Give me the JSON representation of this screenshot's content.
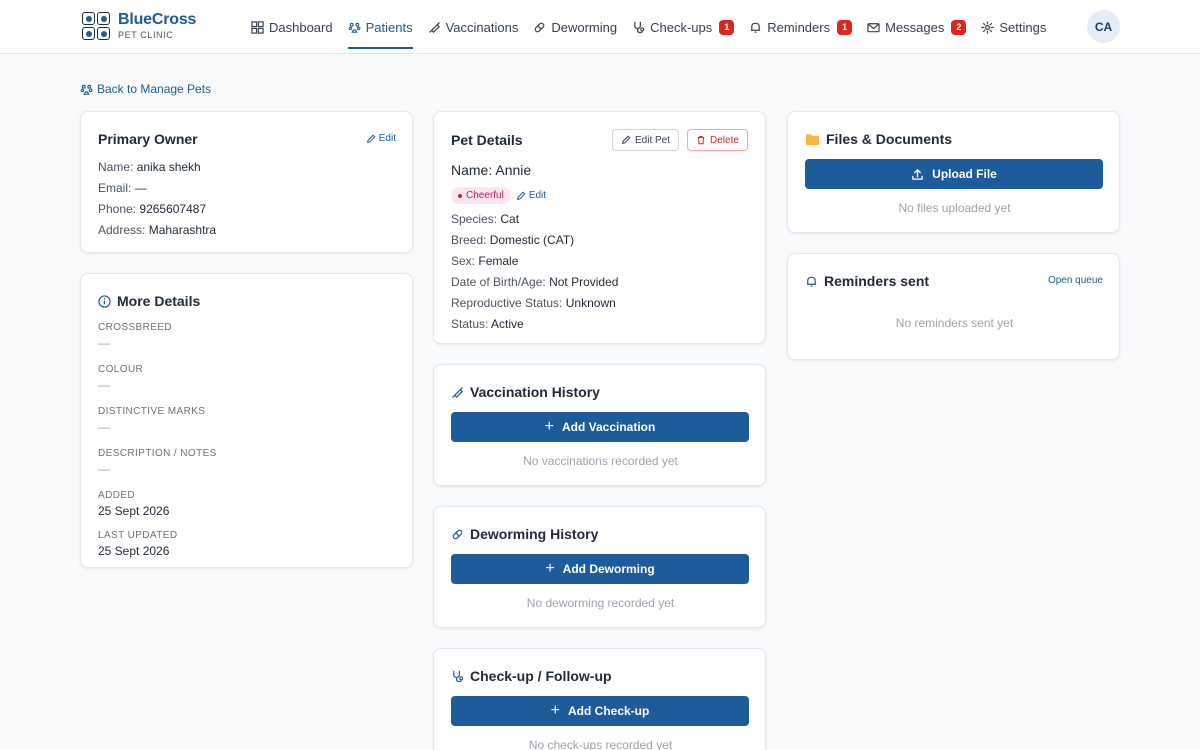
{
  "app": {
    "brand": "BlueCross",
    "subtitle": "PET CLINIC",
    "avatar_initials": "CA"
  },
  "nav": {
    "dashboard": "Dashboard",
    "patients": "Patients",
    "vaccinations": "Vaccinations",
    "deworming": "Deworming",
    "checkups": "Check-ups",
    "checkups_badge": "1",
    "reminders": "Reminders",
    "reminders_badge": "1",
    "messages": "Messages",
    "messages_badge": "2",
    "settings": "Settings"
  },
  "back_link": "Back to Manage Pets",
  "owner": {
    "title": "Primary Owner",
    "edit": "Edit",
    "name_label": "Name:",
    "name": "anika shekh",
    "email_label": "Email:",
    "email": "—",
    "phone_label": "Phone:",
    "phone": "9265607487",
    "address_label": "Address:",
    "address": "Maharashtra"
  },
  "more": {
    "title": "More Details",
    "crossbreed_label": "CROSSBREED",
    "crossbreed": "—",
    "colour_label": "COLOUR",
    "colour": "—",
    "marks_label": "DISTINCTIVE MARKS",
    "marks": "—",
    "notes_label": "DESCRIPTION / NOTES",
    "notes": "—",
    "added_label": "ADDED",
    "added": "25 Sept 2026",
    "updated_label": "LAST UPDATED",
    "updated": "25 Sept 2026"
  },
  "pet": {
    "title": "Pet Details",
    "edit_pet": "Edit Pet",
    "delete": "Delete",
    "name_line": "Name: Annie",
    "temperament": "Cheerful",
    "temperament_edit": "Edit",
    "species_label": "Species:",
    "species": "Cat",
    "breed_label": "Breed:",
    "breed": "Domestic (CAT)",
    "sex_label": "Sex:",
    "sex": "Female",
    "dob_label": "Date of Birth/Age:",
    "dob": "Not Provided",
    "repro_label": "Reproductive Status:",
    "repro": "Unknown",
    "status_label": "Status:",
    "status": "Active"
  },
  "vaccination": {
    "title": "Vaccination History",
    "button": "Add Vaccination",
    "empty": "No vaccinations recorded yet"
  },
  "deworming": {
    "title": "Deworming History",
    "button": "Add Deworming",
    "empty": "No deworming recorded yet"
  },
  "checkup": {
    "title": "Check-up / Follow-up",
    "button": "Add Check-up",
    "empty": "No check-ups recorded yet"
  },
  "files": {
    "title": "Files & Documents",
    "button": "Upload File",
    "empty": "No files uploaded yet"
  },
  "reminders": {
    "title": "Reminders sent",
    "open_queue": "Open queue",
    "empty": "No reminders sent yet"
  },
  "colors": {
    "primary": "#1e5b9a",
    "danger": "#dc2626",
    "tag_bg": "#fde7ef",
    "tag_text": "#be185d",
    "folder": "#f5b83d"
  }
}
